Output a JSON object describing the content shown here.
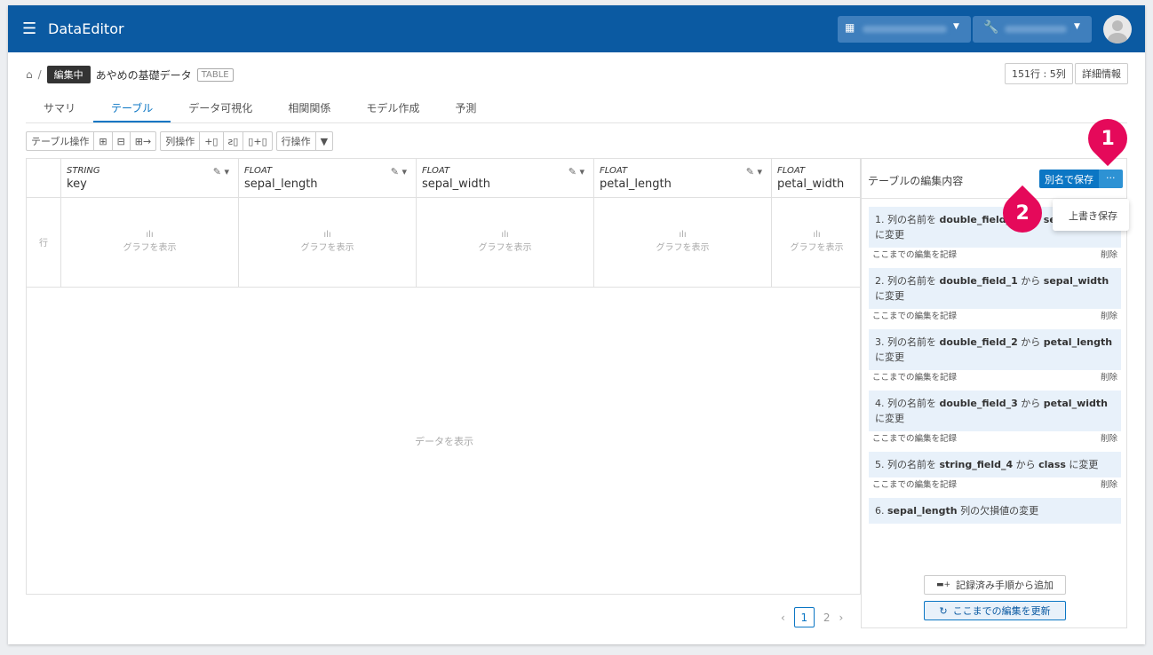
{
  "app": {
    "title": "DataEditor"
  },
  "breadcrumb": {
    "status": "編集中",
    "name": "あやめの基礎データ",
    "type": "TABLE"
  },
  "meta": {
    "size": "151行 : 5列",
    "details": "詳細情報"
  },
  "tabs": [
    "サマリ",
    "テーブル",
    "データ可視化",
    "相関関係",
    "モデル作成",
    "予測"
  ],
  "toolbar": {
    "table_ops": "テーブル操作",
    "col_ops": "列操作",
    "row_ops": "行操作"
  },
  "columns": [
    {
      "type": "STRING",
      "name": "key"
    },
    {
      "type": "FLOAT",
      "name": "sepal_length"
    },
    {
      "type": "FLOAT",
      "name": "sepal_width"
    },
    {
      "type": "FLOAT",
      "name": "petal_length"
    },
    {
      "type": "FLOAT",
      "name": "petal_width"
    }
  ],
  "grid": {
    "row_label": "行",
    "show_graph": "グラフを表示",
    "show_data": "データを表示"
  },
  "pagination": {
    "current": "1",
    "next_page": "2"
  },
  "panel": {
    "title": "テーブルの編集内容",
    "save_as": "別名で保存",
    "more": "···",
    "overwrite": "上書き保存",
    "record": "ここまでの編集を記録",
    "delete": "削除",
    "steps": [
      {
        "pre": "1. 列の名前を ",
        "a": "double_field_0",
        "mid": " から ",
        "b": "sepal_length",
        "post": " に変更"
      },
      {
        "pre": "2. 列の名前を ",
        "a": "double_field_1",
        "mid": " から ",
        "b": "sepal_width",
        "post": " に変更"
      },
      {
        "pre": "3. 列の名前を ",
        "a": "double_field_2",
        "mid": " から ",
        "b": "petal_length",
        "post": " に変更"
      },
      {
        "pre": "4. 列の名前を ",
        "a": "double_field_3",
        "mid": " から ",
        "b": "petal_width",
        "post": " に変更"
      },
      {
        "pre": "5. 列の名前を ",
        "a": "string_field_4",
        "mid": " から ",
        "b": "class",
        "post": " に変更"
      },
      {
        "pre": "6. ",
        "a": "sepal_length",
        "mid": " 列の欠損値の変更",
        "b": "",
        "post": ""
      }
    ],
    "add_from_recorded": "記録済み手順から追加",
    "refresh": "ここまでの編集を更新"
  },
  "callouts": [
    "1",
    "2"
  ],
  "colors": {
    "header": "#0b5aa2",
    "accent": "#0b76c4",
    "callout": "#e5095a"
  }
}
